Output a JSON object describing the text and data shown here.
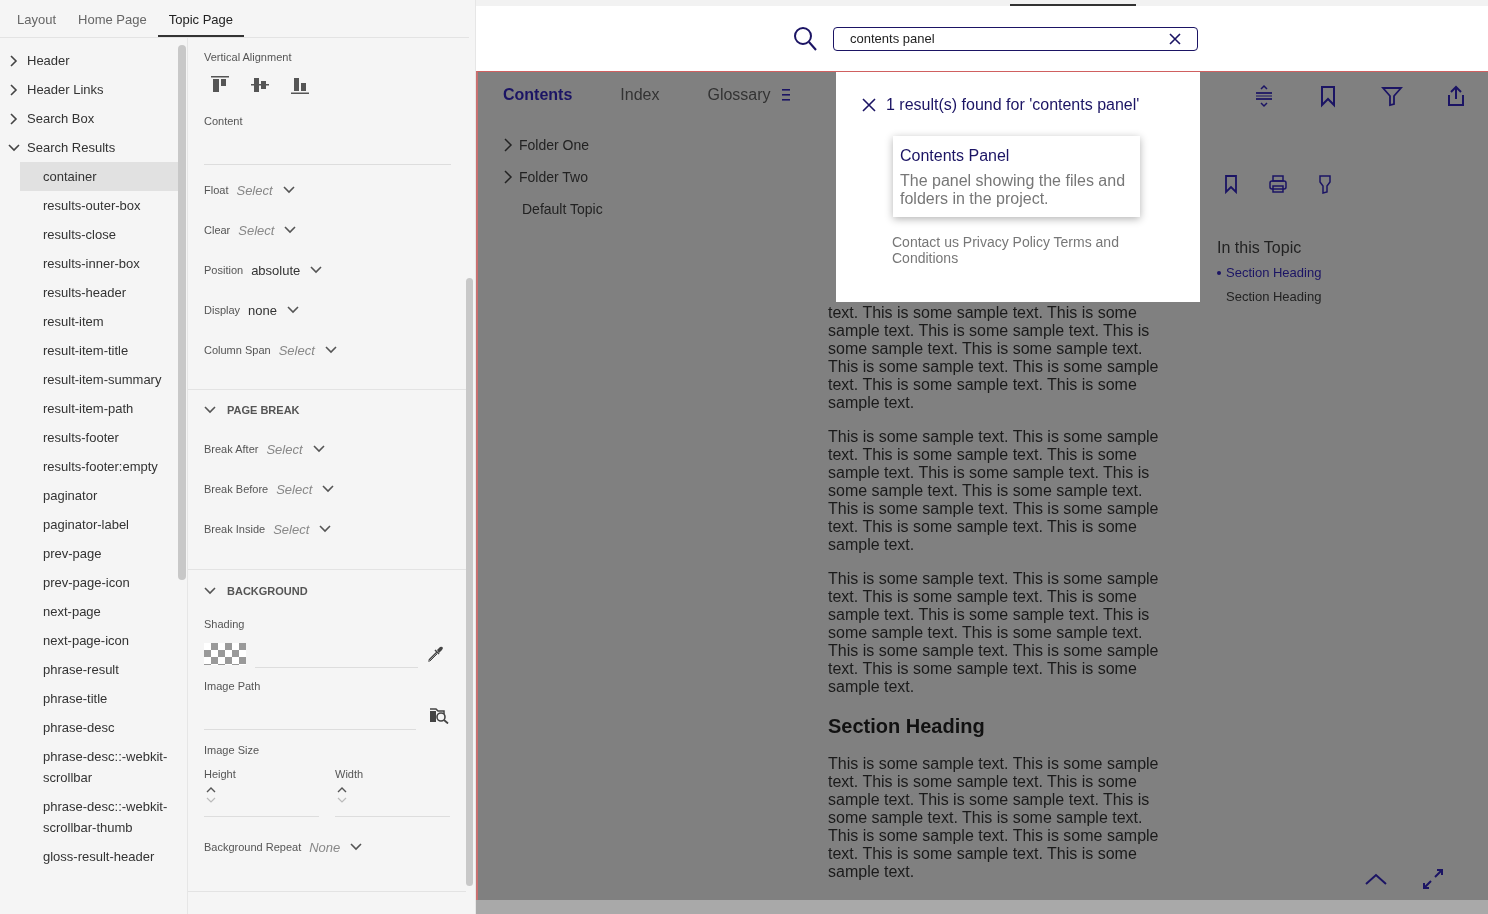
{
  "editor": {
    "tabs": [
      {
        "label": "Layout",
        "selected": false
      },
      {
        "label": "Home Page",
        "selected": false
      },
      {
        "label": "Topic Page",
        "selected": true
      }
    ],
    "tree": [
      {
        "label": "Header",
        "expanded": false,
        "selected": false
      },
      {
        "label": "Header Links",
        "expanded": false,
        "selected": false
      },
      {
        "label": "Search Box",
        "expanded": false,
        "selected": false
      },
      {
        "label": "Search Results",
        "expanded": true,
        "selected": false,
        "children": [
          {
            "label": "container",
            "selected": true
          },
          {
            "label": "results-outer-box",
            "selected": false
          },
          {
            "label": "results-close",
            "selected": false
          },
          {
            "label": "results-inner-box",
            "selected": false
          },
          {
            "label": "results-header",
            "selected": false
          },
          {
            "label": "result-item",
            "selected": false
          },
          {
            "label": "result-item-title",
            "selected": false
          },
          {
            "label": "result-item-summary",
            "selected": false
          },
          {
            "label": "result-item-path",
            "selected": false
          },
          {
            "label": "results-footer",
            "selected": false
          },
          {
            "label": "results-footer:empty",
            "selected": false
          },
          {
            "label": "paginator",
            "selected": false
          },
          {
            "label": "paginator-label",
            "selected": false
          },
          {
            "label": "prev-page",
            "selected": false
          },
          {
            "label": "prev-page-icon",
            "selected": false
          },
          {
            "label": "next-page",
            "selected": false
          },
          {
            "label": "next-page-icon",
            "selected": false
          },
          {
            "label": "phrase-result",
            "selected": false
          },
          {
            "label": "phrase-title",
            "selected": false
          },
          {
            "label": "phrase-desc",
            "selected": false
          },
          {
            "label": "phrase-desc::-webkit-scrollbar",
            "selected": false
          },
          {
            "label": "phrase-desc::-webkit-scrollbar-thumb",
            "selected": false
          },
          {
            "label": "gloss-result-header",
            "selected": false
          }
        ]
      }
    ],
    "properties": {
      "vertical_alignment": "Vertical Alignment",
      "content": "Content",
      "selects": [
        {
          "label": "Float",
          "placeholder": "Select"
        },
        {
          "label": "Clear",
          "placeholder": "Select"
        },
        {
          "label": "Position",
          "value": "absolute"
        },
        {
          "label": "Display",
          "value": "none"
        },
        {
          "label": "Column Span",
          "placeholder": "Select"
        }
      ],
      "sections": [
        {
          "kind": "selects",
          "title": "PAGE BREAK",
          "expanded": true,
          "selects": [
            {
              "label": "Break After",
              "placeholder": "Select"
            },
            {
              "label": "Break Before",
              "placeholder": "Select"
            },
            {
              "label": "Break Inside",
              "placeholder": "Select"
            }
          ]
        },
        {
          "kind": "background",
          "title": "BACKGROUND",
          "expanded": true,
          "shading": "Shading",
          "image_path": "Image Path",
          "image_size": "Image Size",
          "height": "Height",
          "width": "Width",
          "repeat": {
            "label": "Background Repeat",
            "placeholder": "None"
          }
        }
      ]
    }
  },
  "preview": {
    "search": {
      "value": "contents panel"
    },
    "nav_tabs": [
      {
        "label": "Contents",
        "selected": true
      },
      {
        "label": "Index",
        "selected": false
      },
      {
        "label": "Glossary",
        "selected": false
      }
    ],
    "folders": [
      {
        "label": "Folder One",
        "kind": "folder"
      },
      {
        "label": "Folder Two",
        "kind": "folder"
      },
      {
        "label": "Default Topic",
        "kind": "topic"
      }
    ],
    "blocks": [
      {
        "kind": "paragraph",
        "text": "text. This is some sample text. This is some sample text. This is some sample text. This is some sample text. This is some sample text. This is some sample text. This is some sample text. This is some sample text. This is some sample text."
      },
      {
        "kind": "paragraph",
        "text": "This is some sample text. This is some sample text. This is some sample text. This is some sample text. This is some sample text. This is some sample text. This is some sample text. This is some sample text. This is some sample text. This is some sample text. This is some sample text."
      },
      {
        "kind": "paragraph",
        "text": "This is some sample text. This is some sample text. This is some sample text. This is some sample text. This is some sample text. This is some sample text. This is some sample text. This is some sample text. This is some sample text. This is some sample text. This is some sample text."
      },
      {
        "kind": "heading",
        "text": "Section Heading"
      },
      {
        "kind": "paragraph",
        "text": "This is some sample text. This is some sample text. This is some sample text. This is some sample text. This is some sample text. This is some sample text. This is some sample text. This is some sample text. This is some sample text. This is some sample text. This is some sample text."
      }
    ],
    "topic": {
      "title": "In this Topic",
      "items": [
        {
          "label": "Section Heading",
          "selected": true
        },
        {
          "label": "Section Heading",
          "selected": false
        }
      ]
    },
    "results": {
      "summary": "1 result(s) found for 'contents panel'",
      "items": [
        {
          "title": "Contents Panel",
          "summary": "The panel showing the files and folders in the project."
        }
      ],
      "footer": "Contact us Privacy Policy Terms and Conditions"
    }
  }
}
